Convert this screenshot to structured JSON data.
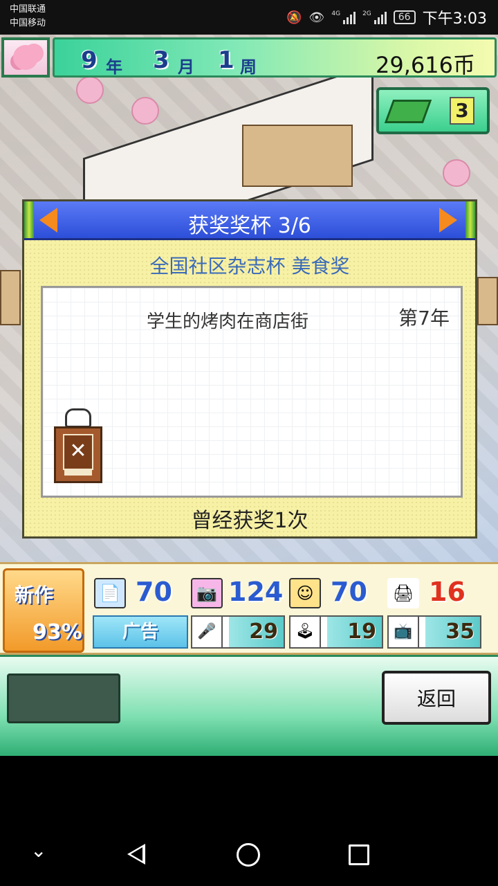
{
  "status_bar": {
    "carrier_1": "中国联通",
    "carrier_2": "中国移动",
    "network_1": "4G",
    "network_2": "2G",
    "battery": "66",
    "time": "下午3:03"
  },
  "top_bar": {
    "year_num": "9",
    "year_unit": "年",
    "month_num": "3",
    "month_unit": "月",
    "week_num": "1",
    "week_unit": "周",
    "money": "29,616币",
    "book_count": "3"
  },
  "dialog": {
    "title": "获奖奖杯 3/6",
    "award_name": "全国社区杂志杯 美食奖",
    "work_title": "学生的烤肉在商店街",
    "year_label": "第7年",
    "won_times": "曾经获奖1次"
  },
  "stats": {
    "new_label": "新作",
    "new_percent": "93%",
    "stat_1": "70",
    "stat_2": "124",
    "stat_3": "70",
    "stat_4": "16",
    "ad_label": "广告",
    "media_1": "29",
    "media_2": "19",
    "media_3": "35"
  },
  "bottom_menu": {
    "back_label": "返回"
  },
  "colors": {
    "dialog_bg": "#f7f1a6",
    "header_blue": "#2d4fd8",
    "accent_orange": "#f58a1e",
    "stat_blue": "#2a5bd0",
    "stat_red": "#e0321f"
  },
  "icons": [
    "mute-icon",
    "eye-icon",
    "book-icon",
    "trophy-icon",
    "article-icon",
    "photo-icon",
    "smile-icon",
    "ink-icon",
    "microphone-icon",
    "arcade-icon",
    "tv-icon"
  ]
}
